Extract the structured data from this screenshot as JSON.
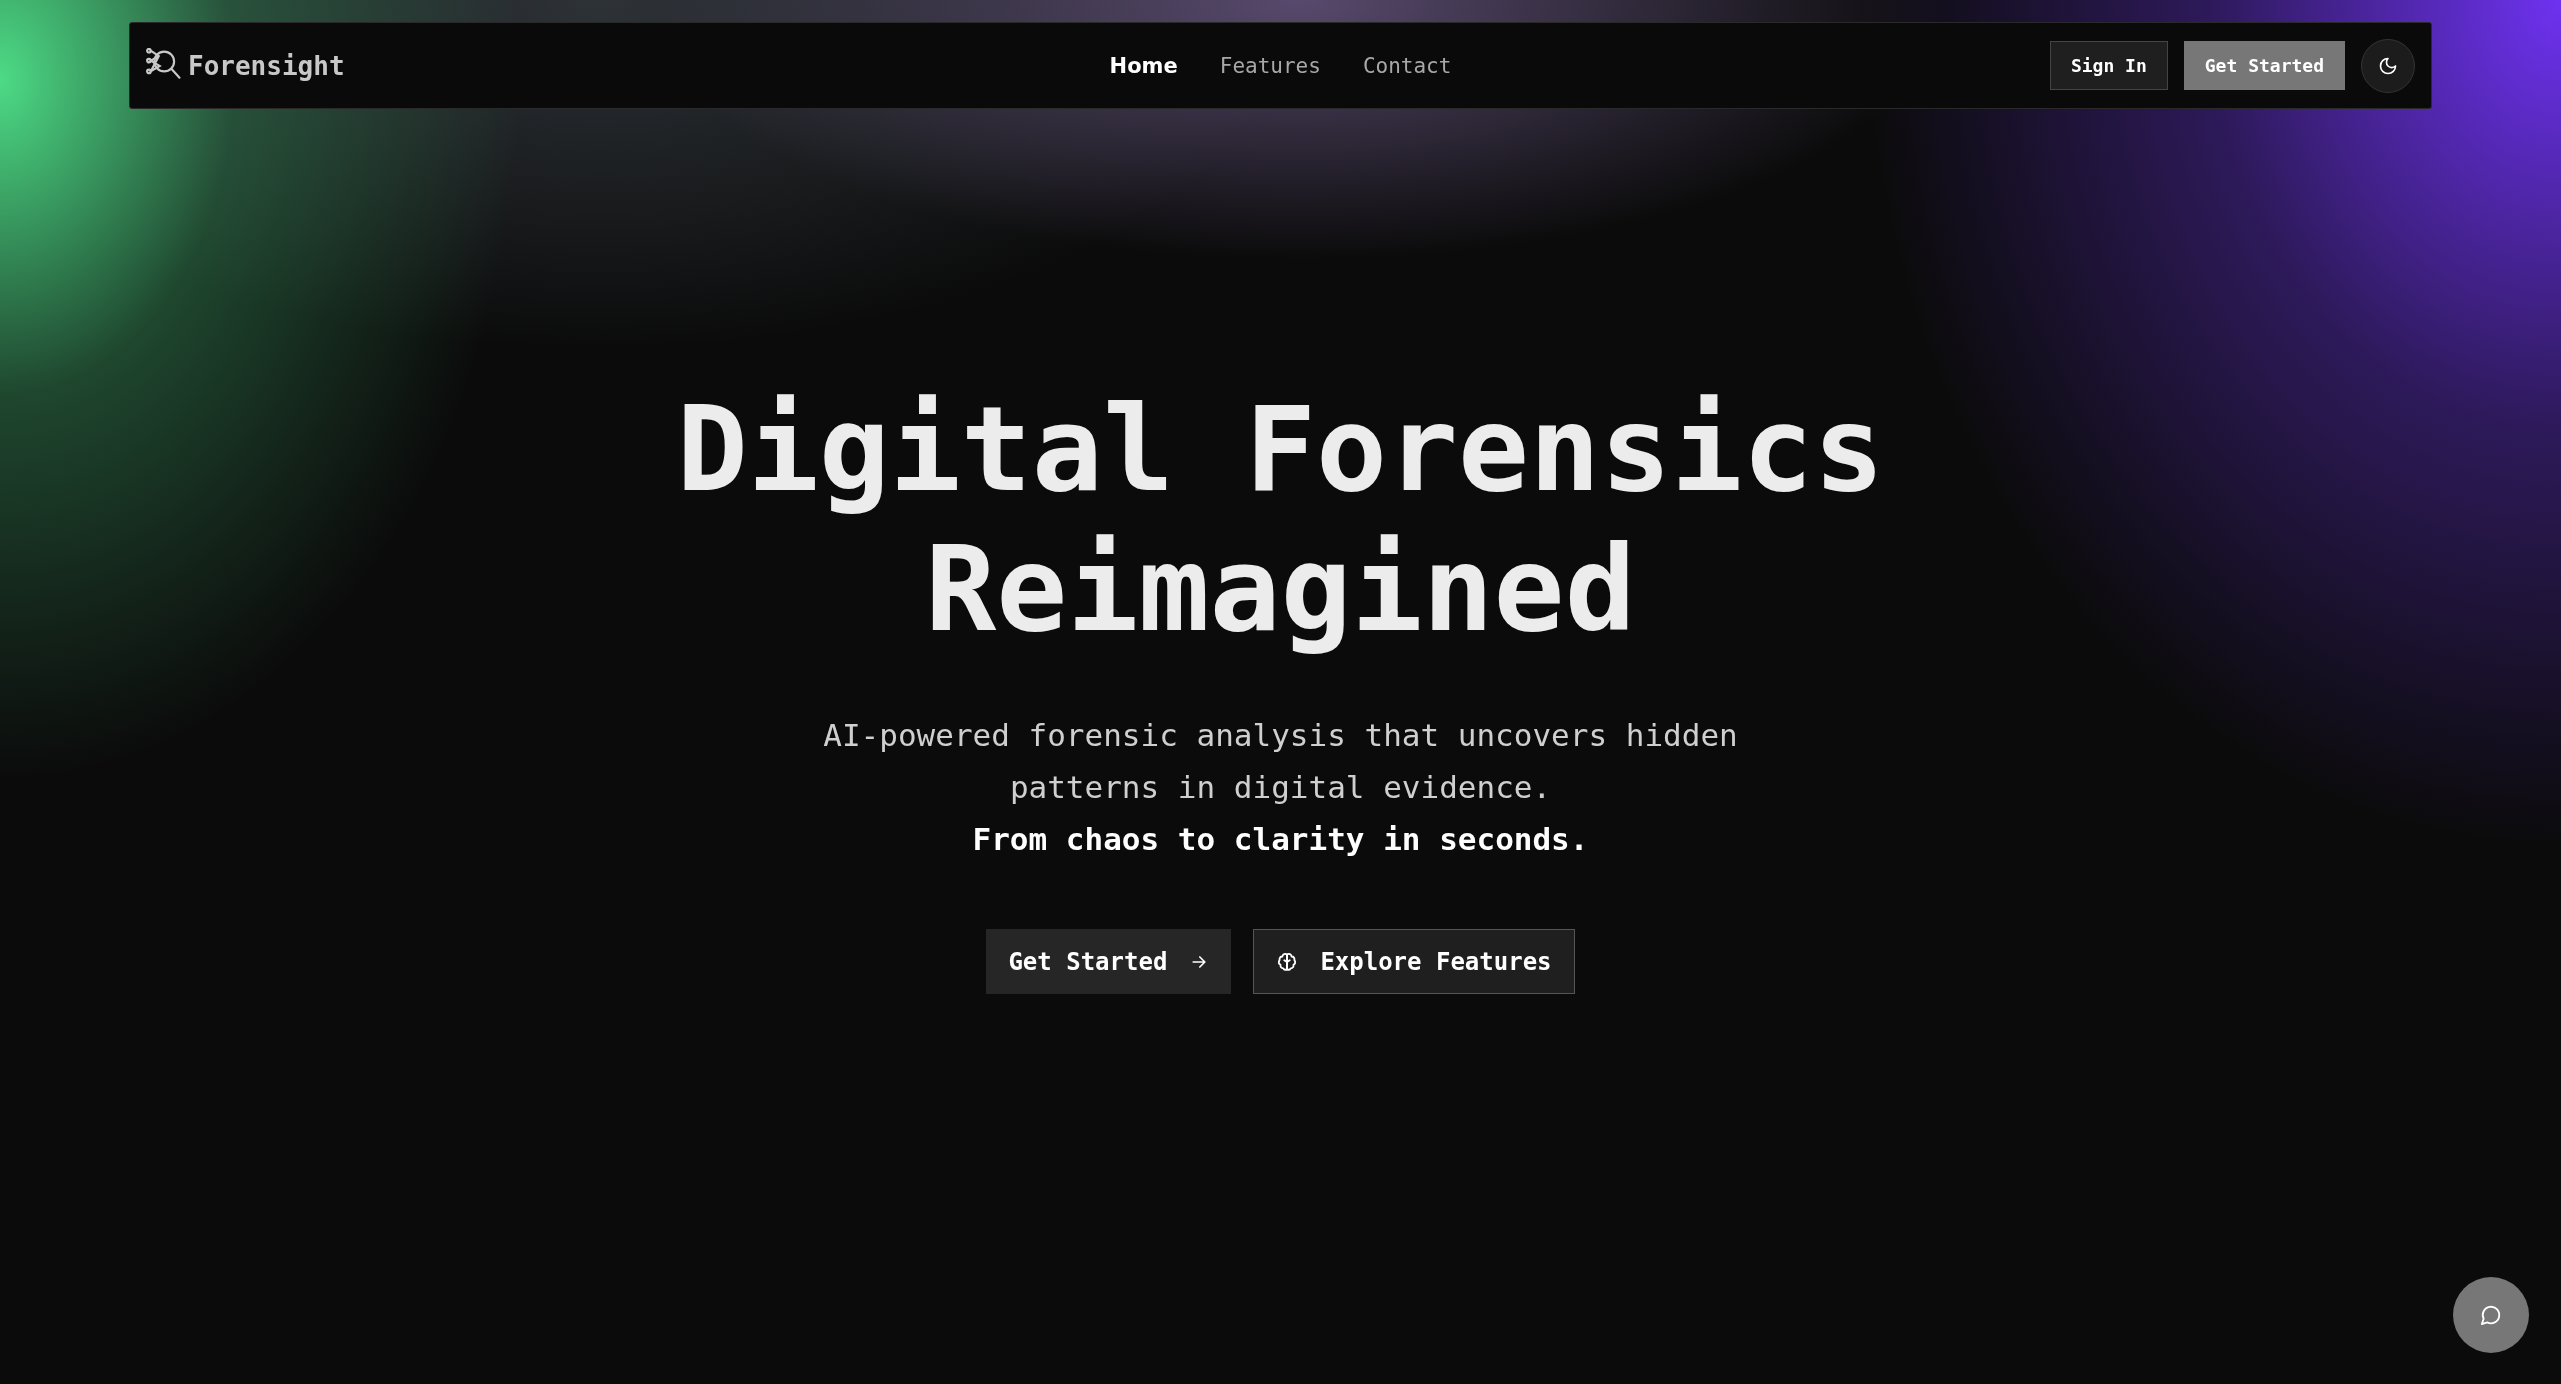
{
  "navbar": {
    "logo": "Forensight",
    "links": [
      {
        "label": "Home",
        "selected": true
      },
      {
        "label": "Features",
        "selected": false
      },
      {
        "label": "Contact",
        "selected": false
      }
    ],
    "sign_in": "Sign In",
    "get_started": "Get Started"
  },
  "hero": {
    "title_lines": [
      "Digital Forensics",
      "Reimagined"
    ],
    "subtitle": "AI-powered forensic analysis that uncovers hidden patterns in digital evidence.",
    "tagline": "From chaos to clarity in seconds.",
    "primary_button": "Get Started",
    "secondary_button": "Explore Features"
  }
}
